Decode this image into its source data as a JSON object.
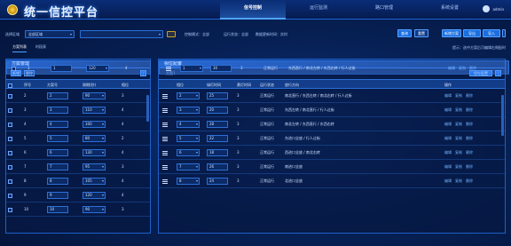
{
  "header": {
    "title": "统一信控平台",
    "nav": [
      "信号控制",
      "运行监测",
      "路口管理",
      "系统设置"
    ],
    "user": "admin"
  },
  "filter": {
    "region_label": "选择区域",
    "region_value": "全部区域",
    "intersection_value": "",
    "chip1": "控制模式：全部",
    "chip2": "运行状态：全部",
    "chip3": "数据更新时间：实时",
    "btn_query": "查询",
    "btn_reset": "重置",
    "btn_add": "新增方案",
    "btn_export": "导出",
    "btn_import": "导入",
    "btn_setting": "设置"
  },
  "subtabs": [
    "方案列表",
    "时段表"
  ],
  "note": "提示：选中方案后可编辑右侧配时",
  "left_panel": {
    "title": "方案管理",
    "btn_add": "新增",
    "btn_del": "删除",
    "columns": [
      "",
      "序号",
      "方案号",
      "周期(秒)",
      "相位"
    ],
    "rows": [
      {
        "idx": "1",
        "plan": "1",
        "cycle": "120",
        "phase": "4"
      },
      {
        "idx": "2",
        "plan": "2",
        "cycle": "90",
        "phase": "3"
      },
      {
        "idx": "3",
        "plan": "3",
        "cycle": "110",
        "phase": "4"
      },
      {
        "idx": "4",
        "plan": "4",
        "cycle": "100",
        "phase": "4"
      },
      {
        "idx": "5",
        "plan": "5",
        "cycle": "80",
        "phase": "2"
      },
      {
        "idx": "6",
        "plan": "6",
        "cycle": "130",
        "phase": "4"
      },
      {
        "idx": "7",
        "plan": "7",
        "cycle": "95",
        "phase": "3"
      },
      {
        "idx": "8",
        "plan": "8",
        "cycle": "105",
        "phase": "4"
      },
      {
        "idx": "9",
        "plan": "9",
        "cycle": "120",
        "phase": "4"
      },
      {
        "idx": "10",
        "plan": "10",
        "cycle": "90",
        "phase": "3"
      }
    ]
  },
  "right_panel": {
    "title": "相位配置",
    "sub": "方案1",
    "btn_save": "保存配置",
    "columns": [
      "",
      "相位",
      "绿灯时间",
      "黄灯时间",
      "运行状态",
      "放行方向",
      "",
      "操作"
    ],
    "rows": [
      {
        "phase": "1",
        "green": "30",
        "yellow": "3",
        "status": "正常运行",
        "dir": "东西直行 / 南北左转 / 东西右转 / 行人过街"
      },
      {
        "phase": "2",
        "green": "25",
        "yellow": "3",
        "status": "正常运行",
        "dir": "南北直行 / 东西左转 / 南北右转 / 行人过街"
      },
      {
        "phase": "3",
        "green": "20",
        "yellow": "3",
        "status": "正常运行",
        "dir": "东西左转 / 南北直行 / 行人过街"
      },
      {
        "phase": "4",
        "green": "28",
        "yellow": "3",
        "status": "正常运行",
        "dir": "南北左转 / 东西直行 / 东西右转"
      },
      {
        "phase": "5",
        "green": "22",
        "yellow": "3",
        "status": "正常运行",
        "dir": "东进口全放 / 行人过街"
      },
      {
        "phase": "6",
        "green": "18",
        "yellow": "3",
        "status": "正常运行",
        "dir": "西进口全放 / 南北右转"
      },
      {
        "phase": "7",
        "green": "26",
        "yellow": "3",
        "status": "正常运行",
        "dir": "南进口全放"
      },
      {
        "phase": "8",
        "green": "24",
        "yellow": "3",
        "status": "正常运行",
        "dir": "北进口全放"
      }
    ],
    "op_edit": "编辑",
    "op_copy": "复制",
    "op_del": "删除"
  }
}
